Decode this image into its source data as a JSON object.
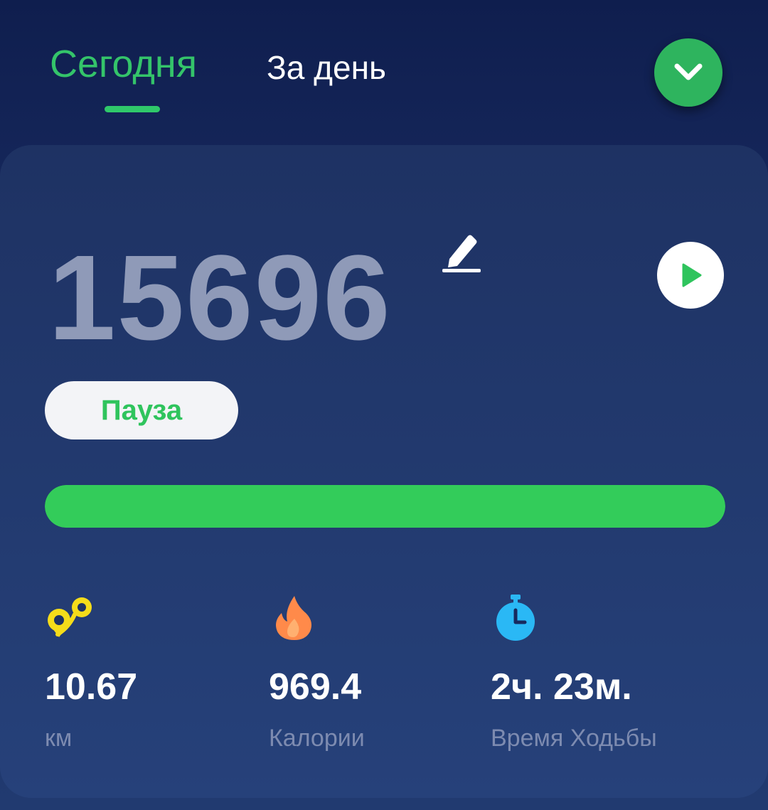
{
  "tabs": {
    "today": "Сегодня",
    "per_day": "За день"
  },
  "steps": {
    "count": "15696",
    "progress_percent": 100
  },
  "buttons": {
    "pause_label": "Пауза"
  },
  "stats": {
    "distance": {
      "value": "10.67",
      "unit": "км",
      "icon": "map-pin-icon"
    },
    "calories": {
      "value": "969.4",
      "unit": "Калории",
      "icon": "flame-icon"
    },
    "walk_time": {
      "value": "2ч. 23м.",
      "unit": "Время Ходьбы",
      "icon": "stopwatch-icon"
    }
  },
  "colors": {
    "accent_green": "#34c46a",
    "progress_green": "#33cc5a",
    "distance_yellow": "#f5dc1a",
    "calorie_orange": "#ff8a4a",
    "time_blue": "#2ab8f5"
  }
}
